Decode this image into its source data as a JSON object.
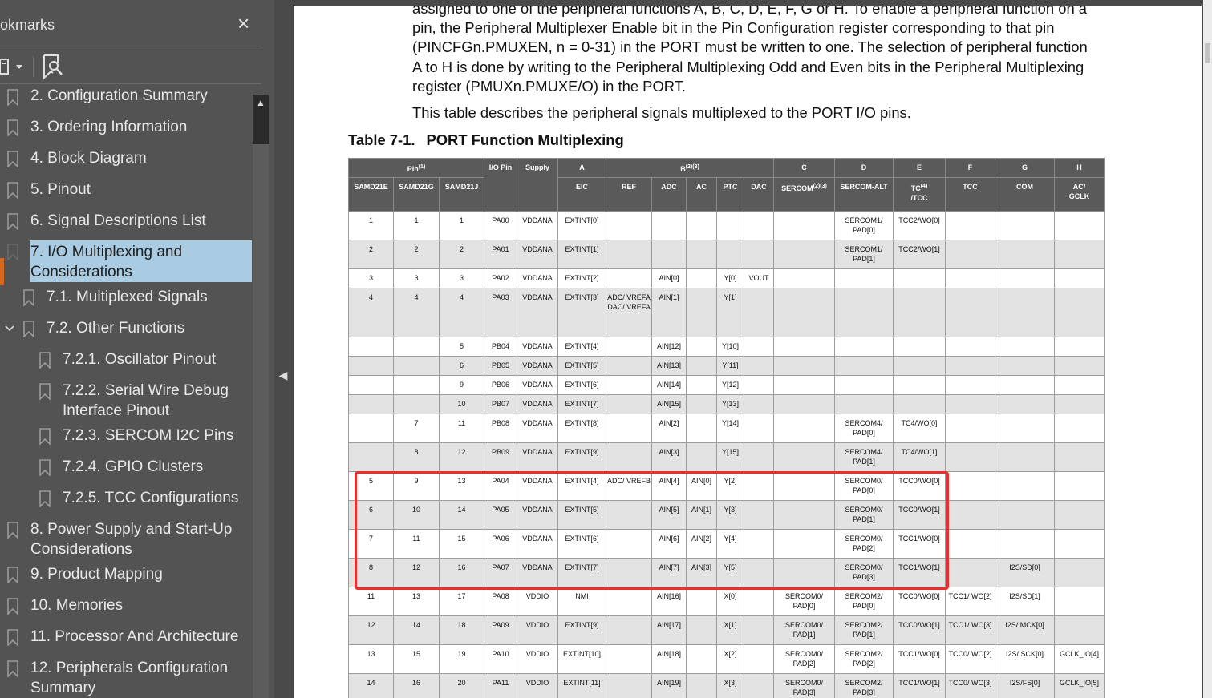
{
  "sidebar": {
    "title": "okmarks",
    "close_symbol": "×",
    "tools": {
      "options_icon": "bookmark-options-icon",
      "find_icon": "find-bookmark-icon"
    },
    "bookmarks": [
      {
        "label": "2. Configuration Summary",
        "level": 0
      },
      {
        "label": "3. Ordering Information",
        "level": 0
      },
      {
        "label": "4. Block Diagram",
        "level": 0
      },
      {
        "label": "5. Pinout",
        "level": 0
      },
      {
        "label": "6. Signal Descriptions List",
        "level": 0
      },
      {
        "label_line1": "7. I/O Multiplexing and",
        "label_line2": "Considerations",
        "level": 0,
        "selected": true
      },
      {
        "label": "7.1. Multiplexed Signals",
        "level": 1
      },
      {
        "label": "7.2. Other Functions",
        "level": 1,
        "expanded": true
      },
      {
        "label": "7.2.1. Oscillator Pinout",
        "level": 2
      },
      {
        "label_line1": "7.2.2. Serial Wire Debug",
        "label_line2": "Interface Pinout",
        "level": 2
      },
      {
        "label": "7.2.3. SERCOM I2C Pins",
        "level": 2
      },
      {
        "label": "7.2.4. GPIO Clusters",
        "level": 2
      },
      {
        "label": "7.2.5. TCC Configurations",
        "level": 2
      },
      {
        "label_line1": "8. Power Supply and Start-Up",
        "label_line2": "Considerations",
        "level": 0
      },
      {
        "label": "9. Product Mapping",
        "level": 0
      },
      {
        "label": "10. Memories",
        "level": 0
      },
      {
        "label": "11. Processor And Architecture",
        "level": 0
      },
      {
        "label_line1": "12. Peripherals Configuration",
        "label_line2": "Summary",
        "level": 0
      }
    ]
  },
  "document": {
    "para1": {
      "line1": "assigned to one of the peripheral functions A, B, C, D, E, F, G or H. To enable a peripheral function on a",
      "line2": "pin, the Peripheral Multiplexer Enable bit in the Pin Configuration register corresponding to that pin",
      "line3": "(PINCFGn.PMUXEN, n = 0-31) in the PORT must be written to one. The selection of peripheral function",
      "line4": "A to H is done by writing to the Peripheral Multiplexing Odd and Even bits in the Peripheral Multiplexing",
      "line5": "register (PMUXn.PMUXE/O) in the PORT."
    },
    "para2": "This table describes the peripheral signals multiplexed to the PORT I/O pins.",
    "table_caption": {
      "number": "Table 7-1.",
      "title": "PORT Function Multiplexing"
    },
    "table": {
      "header1": {
        "pin": "Pin",
        "pin_sup": "(1)",
        "io_pin": "I/O Pin",
        "supply": "Supply",
        "a": "A",
        "b": "B",
        "b_sup": "(2)(3)",
        "c": "C",
        "d": "D",
        "e": "E",
        "f": "F",
        "g": "G",
        "h": "H"
      },
      "header2": {
        "samd21e": "SAMD21E",
        "samd21g": "SAMD21G",
        "samd21j": "SAMD21J",
        "eic": "EIC",
        "ref": "REF",
        "adc": "ADC",
        "ac": "AC",
        "ptc": "PTC",
        "dac": "DAC",
        "sercom": "SERCOM",
        "sercom_sup": "(2)(3)",
        "sercom_alt": "SERCOM-ALT",
        "tc_line1": "TC",
        "tc_sup": "(4)",
        "tc_line2": "/TCC",
        "tcc": "TCC",
        "com": "COM",
        "acgclk_line1": "AC/",
        "acgclk_line2": "GCLK"
      },
      "rows": [
        [
          "1",
          "1",
          "1",
          "PA00",
          "VDDANA",
          "EXTINT[0]",
          "",
          "",
          "",
          "",
          "",
          "",
          "SERCOM1/ PAD[0]",
          "TCC2/WO[0]",
          "",
          "",
          ""
        ],
        [
          "2",
          "2",
          "2",
          "PA01",
          "VDDANA",
          "EXTINT[1]",
          "",
          "",
          "",
          "",
          "",
          "",
          "SERCOM1/ PAD[1]",
          "TCC2/WO[1]",
          "",
          "",
          ""
        ],
        [
          "3",
          "3",
          "3",
          "PA02",
          "VDDANA",
          "EXTINT[2]",
          "",
          "AIN[0]",
          "",
          "Y[0]",
          "VOUT",
          "",
          "",
          "",
          "",
          "",
          ""
        ],
        [
          "4",
          "4",
          "4",
          "PA03",
          "VDDANA",
          "EXTINT[3]",
          "ADC/ VREFA DAC/ VREFA",
          "AIN[1]",
          "",
          "Y[1]",
          "",
          "",
          "",
          "",
          "",
          "",
          ""
        ],
        [
          "",
          "",
          "5",
          "PB04",
          "VDDANA",
          "EXTINT[4]",
          "",
          "AIN[12]",
          "",
          "Y[10]",
          "",
          "",
          "",
          "",
          "",
          "",
          ""
        ],
        [
          "",
          "",
          "6",
          "PB05",
          "VDDANA",
          "EXTINT[5]",
          "",
          "AIN[13]",
          "",
          "Y[11]",
          "",
          "",
          "",
          "",
          "",
          "",
          ""
        ],
        [
          "",
          "",
          "9",
          "PB06",
          "VDDANA",
          "EXTINT[6]",
          "",
          "AIN[14]",
          "",
          "Y[12]",
          "",
          "",
          "",
          "",
          "",
          "",
          ""
        ],
        [
          "",
          "",
          "10",
          "PB07",
          "VDDANA",
          "EXTINT[7]",
          "",
          "AIN[15]",
          "",
          "Y[13]",
          "",
          "",
          "",
          "",
          "",
          "",
          ""
        ],
        [
          "",
          "7",
          "11",
          "PB08",
          "VDDANA",
          "EXTINT[8]",
          "",
          "AIN[2]",
          "",
          "Y[14]",
          "",
          "",
          "SERCOM4/ PAD[0]",
          "TC4/WO[0]",
          "",
          "",
          ""
        ],
        [
          "",
          "8",
          "12",
          "PB09",
          "VDDANA",
          "EXTINT[9]",
          "",
          "AIN[3]",
          "",
          "Y[15]",
          "",
          "",
          "SERCOM4/ PAD[1]",
          "TC4/WO[1]",
          "",
          "",
          ""
        ],
        [
          "5",
          "9",
          "13",
          "PA04",
          "VDDANA",
          "EXTINT[4]",
          "ADC/ VREFB",
          "AIN[4]",
          "AIN[0]",
          "Y[2]",
          "",
          "",
          "SERCOM0/ PAD[0]",
          "TCC0/WO[0]",
          "",
          "",
          ""
        ],
        [
          "6",
          "10",
          "14",
          "PA05",
          "VDDANA",
          "EXTINT[5]",
          "",
          "AIN[5]",
          "AIN[1]",
          "Y[3]",
          "",
          "",
          "SERCOM0/ PAD[1]",
          "TCC0/WO[1]",
          "",
          "",
          ""
        ],
        [
          "7",
          "11",
          "15",
          "PA06",
          "VDDANA",
          "EXTINT[6]",
          "",
          "AIN[6]",
          "AIN[2]",
          "Y[4]",
          "",
          "",
          "SERCOM0/ PAD[2]",
          "TCC1/WO[0]",
          "",
          "",
          ""
        ],
        [
          "8",
          "12",
          "16",
          "PA07",
          "VDDANA",
          "EXTINT[7]",
          "",
          "AIN[7]",
          "AIN[3]",
          "Y[5]",
          "",
          "",
          "SERCOM0/ PAD[3]",
          "TCC1/WO[1]",
          "",
          "I2S/SD[0]",
          ""
        ],
        [
          "11",
          "13",
          "17",
          "PA08",
          "VDDIO",
          "NMI",
          "",
          "AIN[16]",
          "",
          "X[0]",
          "",
          "SERCOM0/ PAD[0]",
          "SERCOM2/ PAD[0]",
          "TCC0/WO[0]",
          "TCC1/ WO[2]",
          "I2S/SD[1]",
          ""
        ],
        [
          "12",
          "14",
          "18",
          "PA09",
          "VDDIO",
          "EXTINT[9]",
          "",
          "AIN[17]",
          "",
          "X[1]",
          "",
          "SERCOM0/ PAD[1]",
          "SERCOM2/ PAD[1]",
          "TCC0/WO[1]",
          "TCC1/ WO[3]",
          "I2S/ MCK[0]",
          ""
        ],
        [
          "13",
          "15",
          "19",
          "PA10",
          "VDDIO",
          "EXTINT[10]",
          "",
          "AIN[18]",
          "",
          "X[2]",
          "",
          "SERCOM0/ PAD[2]",
          "SERCOM2/ PAD[2]",
          "TCC1/WO[0]",
          "TCC0/ WO[2]",
          "I2S/ SCK[0]",
          "GCLK_IO[4]"
        ],
        [
          "14",
          "16",
          "20",
          "PA11",
          "VDDIO",
          "EXTINT[11]",
          "",
          "AIN[19]",
          "",
          "X[3]",
          "",
          "SERCOM0/ PAD[3]",
          "SERCOM2/ PAD[3]",
          "TCC1/WO[1]",
          "TCC0/ WO[3]",
          "I2S/FS[0]",
          "GCLK_IO[5]"
        ]
      ],
      "highlighted_rows": [
        "PA04",
        "PA05",
        "PA06",
        "PA07"
      ]
    }
  },
  "colors": {
    "sidebar_bg": "#535353",
    "selection": "#a9cce3",
    "highlight_border": "#ef2b2b",
    "header_bg": "#5a5a5a"
  }
}
